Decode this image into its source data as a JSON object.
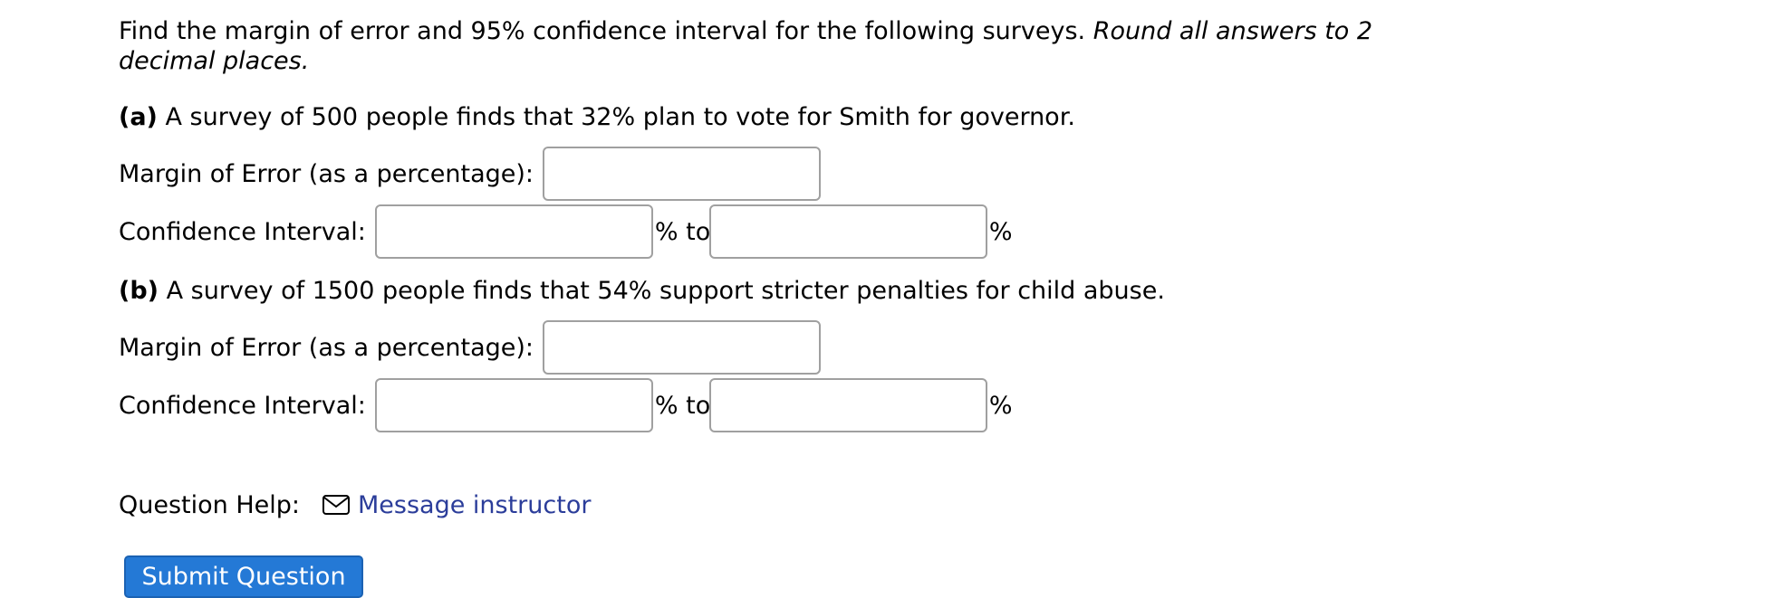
{
  "intro": {
    "text": "Find the margin of error and 95% confidence interval for the following surveys. ",
    "emphasis_line1": "Round all answers to 2",
    "emphasis_line2": "decimal places."
  },
  "part_a": {
    "tag": "(a)",
    "question": " A survey of 500 people finds that 32% plan to vote for Smith for governor.",
    "margin_label": "Margin of Error (as a percentage):",
    "margin_value": "",
    "ci_label": "Confidence Interval:",
    "ci_lower_value": "",
    "ci_to": "% to",
    "ci_upper_value": "",
    "ci_unit": "%"
  },
  "part_b": {
    "tag": "(b)",
    "question": " A survey of 1500 people finds that 54% support stricter penalties for child abuse.",
    "margin_label": "Margin of Error (as a percentage):",
    "margin_value": "",
    "ci_label": "Confidence Interval:",
    "ci_lower_value": "",
    "ci_to": "% to",
    "ci_upper_value": "",
    "ci_unit": "%"
  },
  "help": {
    "label": "Question Help:",
    "icon": "mail-icon",
    "link_text": "Message instructor"
  },
  "submit": {
    "label": "Submit Question"
  },
  "colors": {
    "link": "#2b3d9a",
    "submit_bg": "#2479d6",
    "input_border": "#a0a0a0"
  }
}
